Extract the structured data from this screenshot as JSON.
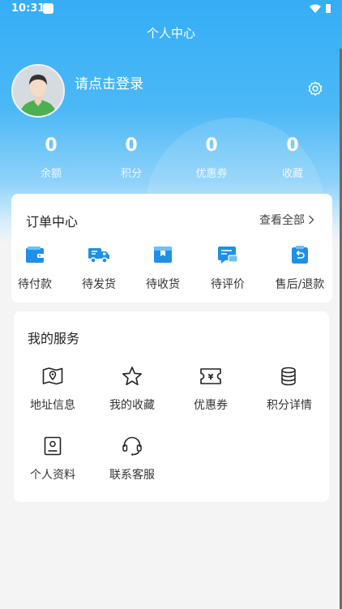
{
  "status_bar": {
    "time": "10:31"
  },
  "header": {
    "title": "个人中心",
    "login_text": "请点击登录"
  },
  "stats": [
    {
      "value": "0",
      "label": "余额"
    },
    {
      "value": "0",
      "label": "积分"
    },
    {
      "value": "0",
      "label": "优惠券"
    },
    {
      "value": "0",
      "label": "收藏"
    }
  ],
  "orders": {
    "title": "订单中心",
    "view_all": "查看全部",
    "items": [
      {
        "label": "待付款",
        "icon": "wallet-icon"
      },
      {
        "label": "待发货",
        "icon": "truck-icon"
      },
      {
        "label": "待收货",
        "icon": "package-icon"
      },
      {
        "label": "待评价",
        "icon": "comment-icon"
      },
      {
        "label": "售后/退款",
        "icon": "return-icon"
      }
    ]
  },
  "services": {
    "title": "我的服务",
    "items": [
      {
        "label": "地址信息",
        "icon": "map-pin-icon"
      },
      {
        "label": "我的收藏",
        "icon": "star-icon"
      },
      {
        "label": "优惠券",
        "icon": "coupon-icon"
      },
      {
        "label": "积分详情",
        "icon": "coins-icon"
      },
      {
        "label": "个人资料",
        "icon": "profile-card-icon"
      },
      {
        "label": "联系客服",
        "icon": "headset-icon"
      }
    ]
  },
  "colors": {
    "primary": "#35aef6",
    "order_icon": "#1e90e6",
    "text": "#333333"
  }
}
